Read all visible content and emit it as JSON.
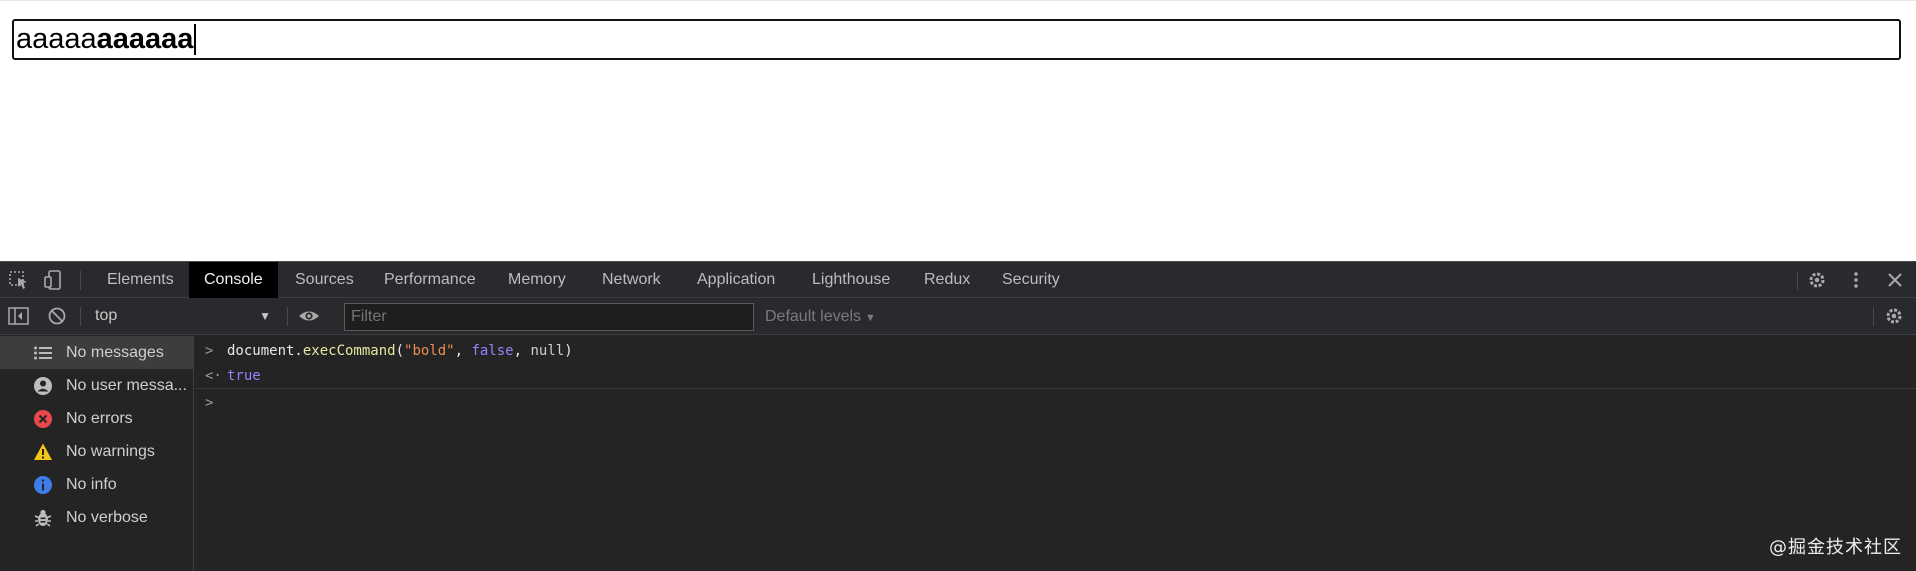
{
  "editor": {
    "plain_text": "aaaaa",
    "bold_text": "aaaaaa"
  },
  "devtools": {
    "tabs": [
      "Elements",
      "Console",
      "Sources",
      "Performance",
      "Memory",
      "Network",
      "Application",
      "Lighthouse",
      "Redux",
      "Security"
    ],
    "active_tab": "Console",
    "context": "top",
    "filter_placeholder": "Filter",
    "levels_label": "Default levels",
    "sidebar": [
      {
        "label": "No messages",
        "icon": "list-icon"
      },
      {
        "label": "No user messa...",
        "icon": "user-icon"
      },
      {
        "label": "No errors",
        "icon": "error-icon"
      },
      {
        "label": "No warnings",
        "icon": "warning-icon"
      },
      {
        "label": "No info",
        "icon": "info-icon"
      },
      {
        "label": "No verbose",
        "icon": "bug-icon"
      }
    ],
    "console": {
      "input_line": {
        "prefix": "document.",
        "method": "execCommand",
        "open": "(",
        "arg1": "\"bold\"",
        "sep1": ", ",
        "arg2": "false",
        "sep2": ", ",
        "arg3": "null",
        "close": ")"
      },
      "result": "true"
    },
    "colors": {
      "error": "#e8474c",
      "warning": "#f5c518",
      "info": "#3f7ee8",
      "prompt": "#4a8ff6"
    }
  },
  "watermark": "@掘金技术社区"
}
